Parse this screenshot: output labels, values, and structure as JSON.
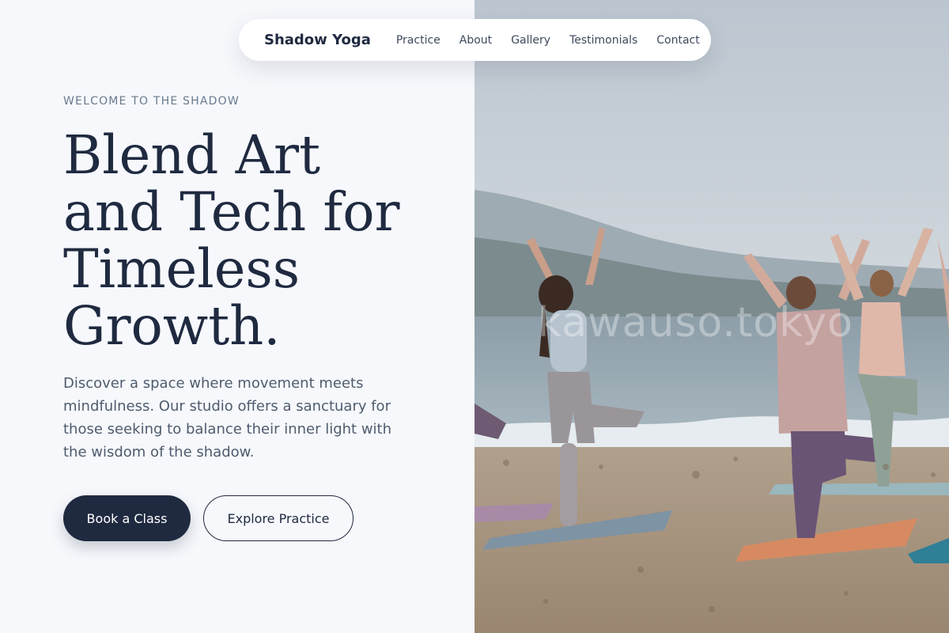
{
  "nav": {
    "brand": "Shadow Yoga",
    "links": [
      "Practice",
      "About",
      "Gallery",
      "Testimonials",
      "Contact"
    ]
  },
  "hero": {
    "eyebrow": "WELCOME TO THE SHADOW",
    "headline_lines": [
      "Blend Art",
      "and Tech for",
      "Timeless",
      "Growth."
    ],
    "description": "Discover a space where movement meets mindfulness. Our studio offers a sanctuary for those seeking to balance their inner light with the wisdom of the shadow.",
    "primary_button": "Book a Class",
    "secondary_button": "Explore Practice"
  },
  "image": {
    "watermark": "kawauso.tokyo"
  },
  "colors": {
    "navy": "#1f2a40",
    "page_bg": "#f6f8fc",
    "muted_text": "#4f5c6d",
    "eyebrow_text": "#6b7a8c"
  }
}
